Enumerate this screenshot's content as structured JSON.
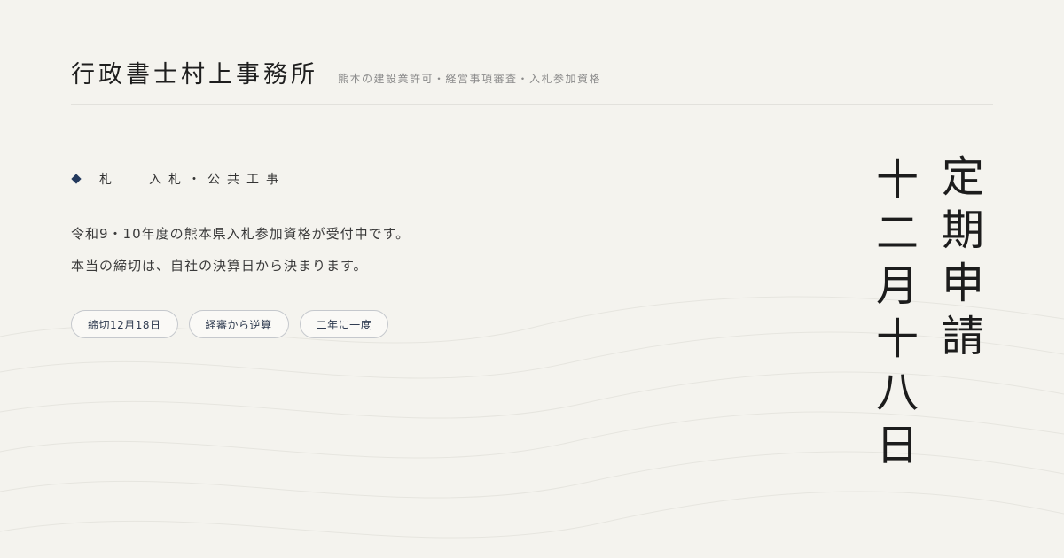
{
  "header": {
    "office_name": "行政書士村上事務所",
    "tagline": "熊本の建設業許可・経営事項審査・入札参加資格"
  },
  "category": {
    "icon": "diamond-icon",
    "kanji": "札",
    "label": "入札・公共工事"
  },
  "body": {
    "line1": "令和9・10年度の熊本県入札参加資格が受付中です。",
    "line2": "本当の締切は、自社の決算日から決まります。"
  },
  "tags": [
    "締切12月18日",
    "経審から逆算",
    "二年に一度"
  ],
  "vertical_title": [
    "定",
    "期",
    "申",
    "請"
  ],
  "vertical_date": [
    "十",
    "二",
    "月",
    "十",
    "八",
    "日"
  ],
  "colors": {
    "background": "#f4f3ee",
    "accent": "#23395d",
    "text": "#222222"
  }
}
